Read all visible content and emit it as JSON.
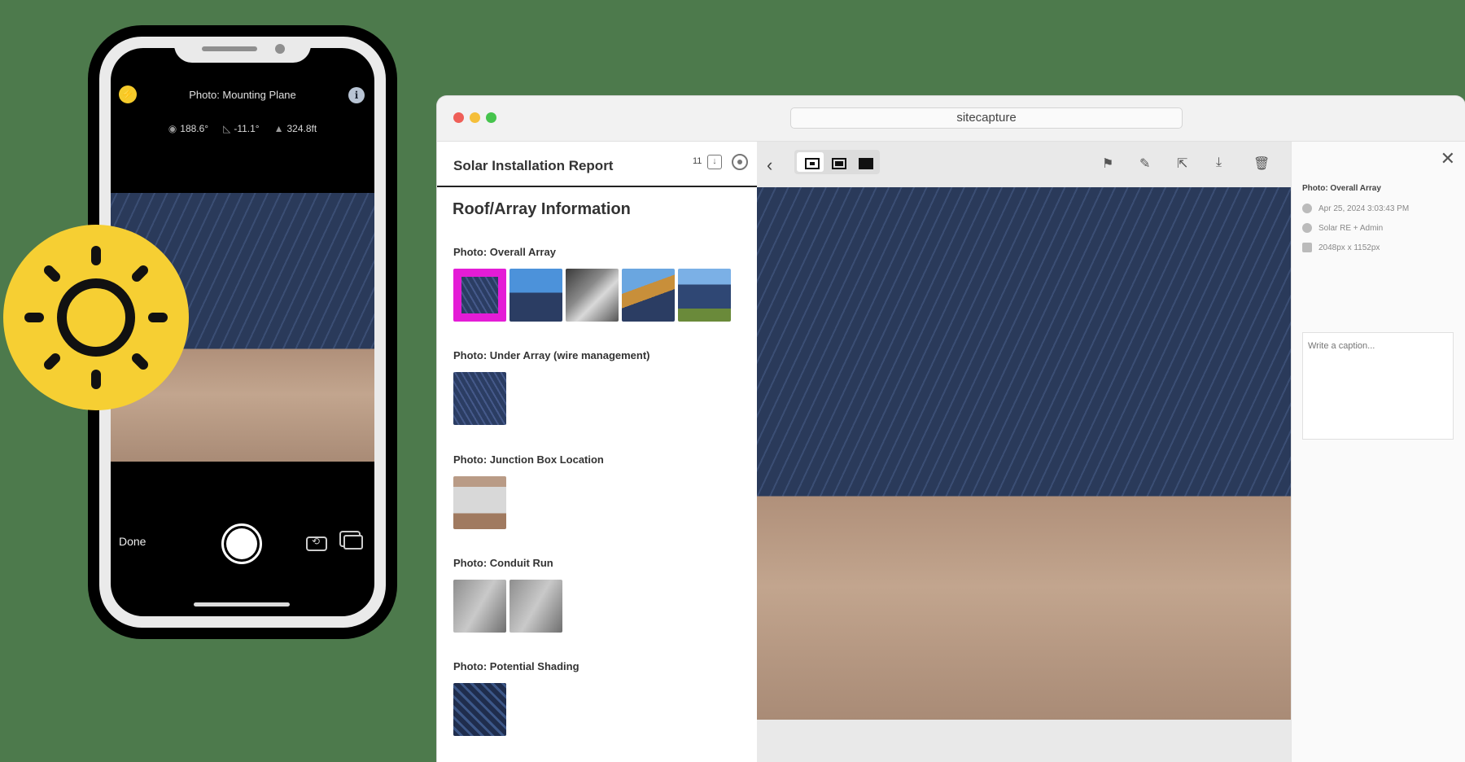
{
  "phone": {
    "title": "Photo: Mounting Plane",
    "heading": "188.6°",
    "tilt": "-11.1°",
    "altitude": "324.8ft",
    "done_label": "Done"
  },
  "window": {
    "url": "sitecapture"
  },
  "report": {
    "title": "Solar Installation Report",
    "count": "11",
    "section": "Roof/Array Information",
    "groups": [
      {
        "label": "Photo: Overall Array"
      },
      {
        "label": "Photo: Under Array (wire management)"
      },
      {
        "label": "Photo: Junction Box Location"
      },
      {
        "label": "Photo: Conduit Run"
      },
      {
        "label": "Photo: Potential Shading"
      }
    ]
  },
  "details": {
    "title": "Photo: Overall Array",
    "date": "Apr 25, 2024 3:03:43 PM",
    "user": "Solar RE + Admin",
    "dimensions": "2048px x 1152px",
    "caption_placeholder": "Write a caption..."
  },
  "colors": {
    "accent_selected": "#e41cd6",
    "sun_badge": "#f6cf33",
    "background": "#4d7a4c"
  }
}
